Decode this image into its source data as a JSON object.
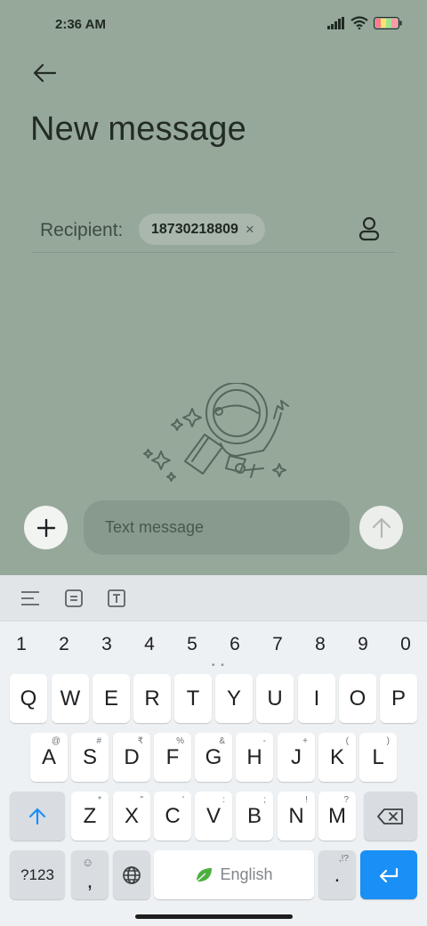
{
  "status_bar": {
    "time": "2:36 AM"
  },
  "header": {
    "title": "New message"
  },
  "recipient": {
    "label": "Recipient:",
    "chip": "18730218809",
    "chip_close": "×"
  },
  "composer": {
    "placeholder": "Text message"
  },
  "keyboard": {
    "numbers": [
      "1",
      "2",
      "3",
      "4",
      "5",
      "6",
      "7",
      "8",
      "9",
      "0"
    ],
    "row1": [
      "Q",
      "W",
      "E",
      "R",
      "T",
      "Y",
      "U",
      "I",
      "O",
      "P"
    ],
    "row2": [
      "A",
      "S",
      "D",
      "F",
      "G",
      "H",
      "J",
      "K",
      "L"
    ],
    "row2_hints": [
      "@",
      "#",
      "₹",
      "%",
      "&",
      "-",
      "+",
      "(",
      ")"
    ],
    "row3": [
      "Z",
      "X",
      "C",
      "V",
      "B",
      "N",
      "M"
    ],
    "row3_hints": [
      "*",
      "\"",
      "'",
      ":",
      ";",
      "!",
      "?"
    ],
    "symbols_label": "?123",
    "comma": ",",
    "space_label": "English",
    "period": ".",
    "period_hint": ",!?"
  },
  "colors": {
    "app_bg": "#96a89a",
    "keyboard_bg": "#eef1f3",
    "accent": "#1a8ff5"
  }
}
